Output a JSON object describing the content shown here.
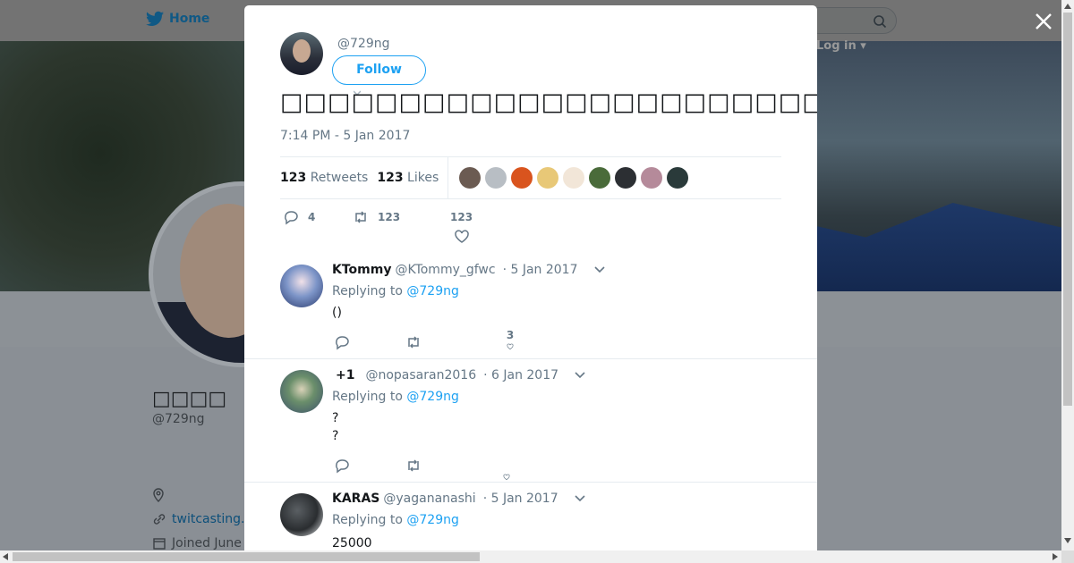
{
  "background": {
    "nav": {
      "home_label": "Home",
      "login_label": "Log in"
    },
    "profile": {
      "name": "□□□□",
      "handle": "@729ng",
      "link": "twitcasting.",
      "joined": "Joined June"
    }
  },
  "modal": {
    "author_handle": "@729ng",
    "follow_label": "Follow",
    "tweet_text": "□□□□□□□□□□□□□□□□□□□□□□□□□□□□□□□□□□□□□□□□□□□□□□□□□□□",
    "timestamp": "7:14 PM - 5 Jan 2017",
    "stats": {
      "retweets_count": "123",
      "retweets_label": "Retweets",
      "likes_count": "123",
      "likes_label": "Likes"
    },
    "liker_colors": [
      "#6b5b52",
      "#b8bec4",
      "#d9541e",
      "#e8c877",
      "#f2e6d8",
      "#4a6b3a",
      "#2c2f33",
      "#b58a9a",
      "#2a3a3a"
    ],
    "actions": {
      "replies": "4",
      "retweets": "123",
      "likes": "123"
    },
    "replies": [
      {
        "name": "KTommy",
        "username": "@KTommy_gfwc",
        "date": "· 5 Jan 2017",
        "replying_prefix": "Replying to",
        "replying_to": "@729ng",
        "lines": [
          "()"
        ],
        "like_count": "3",
        "avatar_color": "#4a6fb0"
      },
      {
        "name": "+1",
        "username": "@nopasaran2016",
        "date": "· 6 Jan 2017",
        "replying_prefix": "Replying to",
        "replying_to": "@729ng",
        "lines": [
          "?",
          "?"
        ],
        "like_count": "",
        "avatar_color": "#6a8a6a"
      },
      {
        "name": "KARAS",
        "username": "@yagananashi",
        "date": "· 5 Jan 2017",
        "replying_prefix": "Replying to",
        "replying_to": "@729ng",
        "lines": [
          "25000"
        ],
        "like_count": "",
        "avatar_color": "#2a2d30"
      }
    ]
  },
  "colors": {
    "accent": "#1da1f2",
    "muted": "#657786",
    "text": "#14171a"
  }
}
